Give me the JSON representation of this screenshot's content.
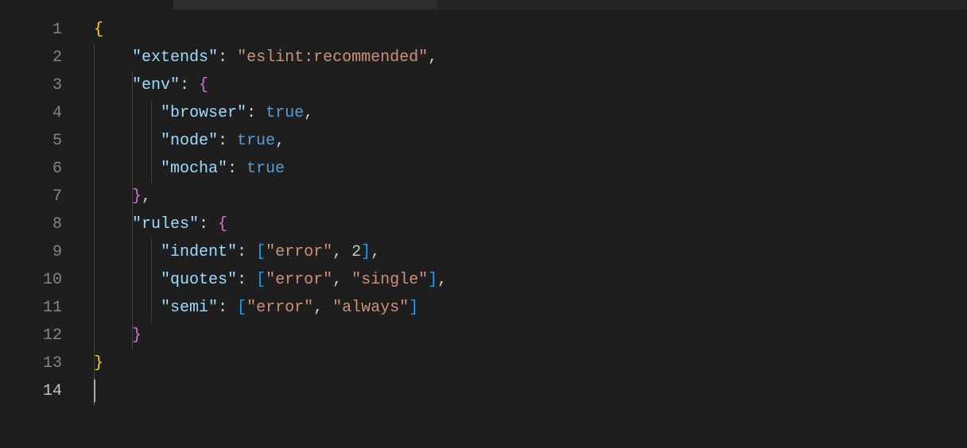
{
  "tabbar": {
    "active": true
  },
  "gutter": {
    "lines": [
      "1",
      "2",
      "3",
      "4",
      "5",
      "6",
      "7",
      "8",
      "9",
      "10",
      "11",
      "12",
      "13",
      "14"
    ],
    "active_index": 13
  },
  "cursor": {
    "line": 14,
    "col": 1
  },
  "code": {
    "l1": {
      "brace": "{"
    },
    "l2": {
      "k": "\"extends\"",
      "c1": ":",
      "sp": " ",
      "v": "\"eslint:recommended\"",
      "c2": ","
    },
    "l3": {
      "k": "\"env\"",
      "c1": ":",
      "sp": " ",
      "brace": "{"
    },
    "l4": {
      "k": "\"browser\"",
      "c1": ":",
      "sp": " ",
      "v": "true",
      "c2": ","
    },
    "l5": {
      "k": "\"node\"",
      "c1": ":",
      "sp": " ",
      "v": "true",
      "c2": ","
    },
    "l6": {
      "k": "\"mocha\"",
      "c1": ":",
      "sp": " ",
      "v": "true"
    },
    "l7": {
      "brace": "}",
      "c2": ","
    },
    "l8": {
      "k": "\"rules\"",
      "c1": ":",
      "sp": " ",
      "brace": "{"
    },
    "l9": {
      "k": "\"indent\"",
      "c1": ":",
      "sp": " ",
      "lb": "[",
      "a1": "\"error\"",
      "cm": ",",
      "sp2": " ",
      "a2": "2",
      "rb": "]",
      "c2": ","
    },
    "l10": {
      "k": "\"quotes\"",
      "c1": ":",
      "sp": " ",
      "lb": "[",
      "a1": "\"error\"",
      "cm": ",",
      "sp2": " ",
      "a2": "\"single\"",
      "rb": "]",
      "c2": ","
    },
    "l11": {
      "k": "\"semi\"",
      "c1": ":",
      "sp": " ",
      "lb": "[",
      "a1": "\"error\"",
      "cm": ",",
      "sp2": " ",
      "a2": "\"always\"",
      "rb": "]"
    },
    "l12": {
      "brace": "}"
    },
    "l13": {
      "brace": "}"
    }
  }
}
